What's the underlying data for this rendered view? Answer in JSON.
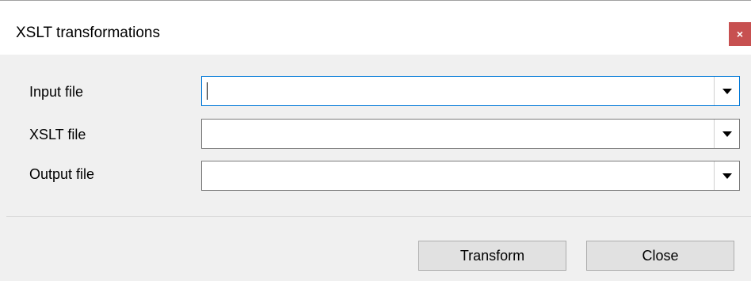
{
  "window": {
    "title": "XSLT transformations",
    "close_label": "×"
  },
  "fields": [
    {
      "label": "Input file",
      "value": "",
      "focused": true
    },
    {
      "label": "XSLT file",
      "value": ""
    },
    {
      "label": "Output file",
      "value": ""
    }
  ],
  "buttons": {
    "transform_label": "Transform",
    "close_label": "Close"
  },
  "icons": {
    "dropdown": "chevron-down-icon",
    "close": "close-icon"
  },
  "colors": {
    "close_button_bg": "#c75050",
    "focus_border": "#0078d7",
    "dialog_bg": "#f0f0f0",
    "button_bg": "#e1e1e1"
  }
}
